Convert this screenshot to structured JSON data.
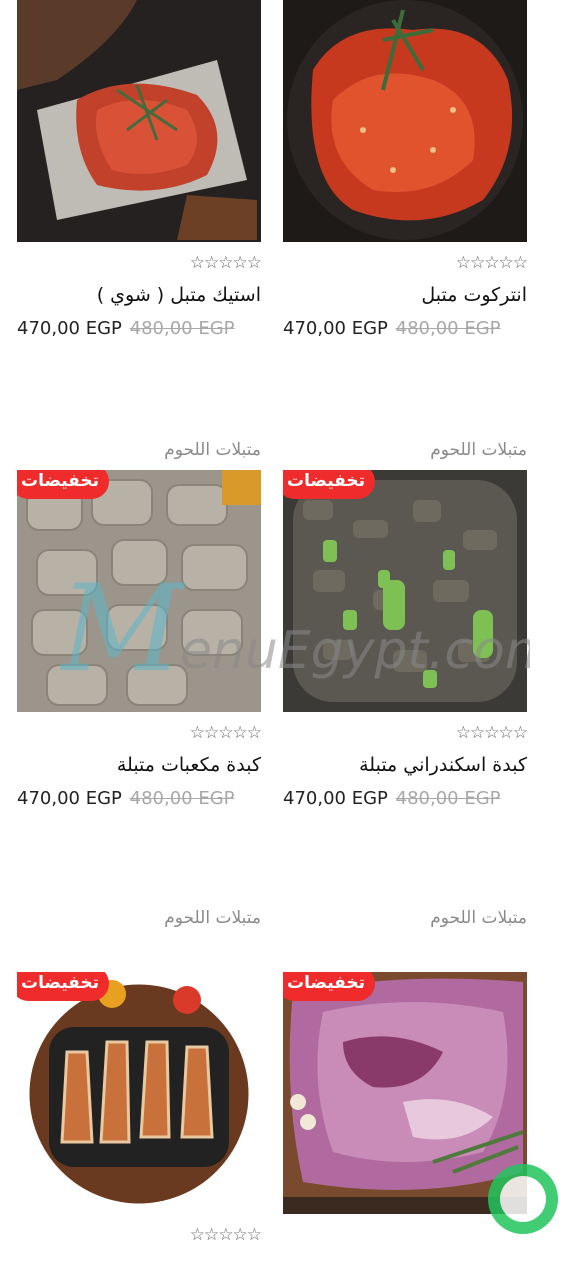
{
  "badge_label": "تخفيضات",
  "rating_icon": "empty-star-icon",
  "products": [
    {
      "id": "p1",
      "category": "",
      "name": "انتركوت متبل",
      "price": "470,00 EGP",
      "old_price": "480,00 EGP",
      "badge": false,
      "photo": "spiced-entrecote"
    },
    {
      "id": "p2",
      "category": "",
      "name": "استيك متبل ( شوي )",
      "price": "470,00 EGP",
      "old_price": "480,00 EGP",
      "badge": false,
      "photo": "grilled-steak"
    },
    {
      "id": "p3",
      "category": "متبلات اللحوم",
      "name": "كبدة اسكندراني متبلة",
      "price": "470,00 EGP",
      "old_price": "480,00 EGP",
      "badge": true,
      "photo": "alexandrian-liver"
    },
    {
      "id": "p4",
      "category": "متبلات اللحوم",
      "name": "كبدة مكعبات متبلة",
      "price": "470,00 EGP",
      "old_price": "480,00 EGP",
      "badge": true,
      "photo": "cubed-liver"
    },
    {
      "id": "p5",
      "category": "متبلات اللحوم",
      "name": "",
      "price": "",
      "old_price": "",
      "badge": true,
      "photo": "lamb-cut"
    },
    {
      "id": "p6",
      "category": "متبلات اللحوم",
      "name": "",
      "price": "",
      "old_price": "",
      "badge": true,
      "photo": "lamb-chops"
    }
  ],
  "watermark": "MenuEgypt.com",
  "colors": {
    "badge": "#ef2b2b",
    "category_text": "#8a8a8a",
    "old_price": "#a8a8a8",
    "fab": "#22c55e"
  }
}
